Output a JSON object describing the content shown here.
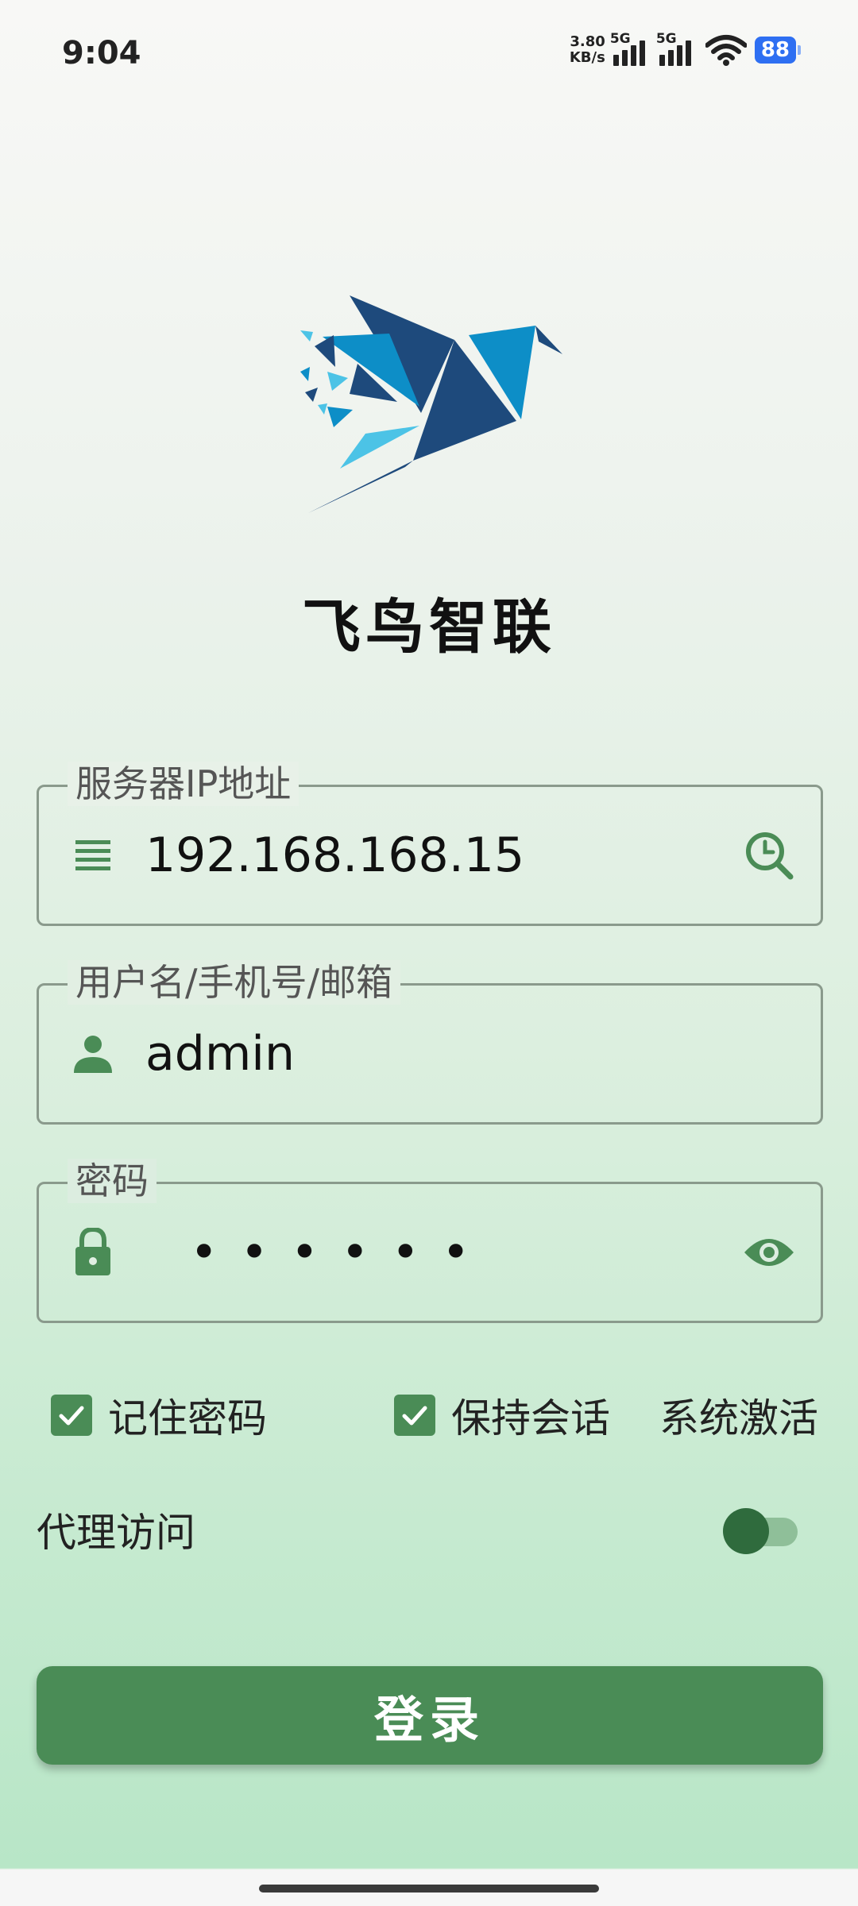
{
  "status_bar": {
    "time": "9:04",
    "net_speed_value": "3.80",
    "net_speed_unit": "KB/s",
    "sim1_label": "5G",
    "sim2_label": "5G",
    "battery": "88"
  },
  "app": {
    "title": "飞鸟智联"
  },
  "form": {
    "server": {
      "label": "服务器IP地址",
      "value": "192.168.168.15"
    },
    "username": {
      "label": "用户名/手机号/邮箱",
      "value": "admin"
    },
    "password": {
      "label": "密码",
      "masked_value": "••••••"
    }
  },
  "options": {
    "remember_password": {
      "label": "记住密码",
      "checked": true
    },
    "keep_session": {
      "label": "保持会话",
      "checked": true
    },
    "activate": "系统激活"
  },
  "proxy": {
    "label": "代理访问",
    "enabled": false
  },
  "login_label": "登录",
  "colors": {
    "accent": "#4a8c56",
    "logo_dark": "#1e4a7c",
    "logo_mid": "#0d8ec7",
    "logo_light": "#4cc3e6"
  },
  "icons": {
    "server": "list-icon",
    "history": "history-search-icon",
    "user": "person-icon",
    "lock": "lock-icon",
    "eye": "eye-icon"
  }
}
